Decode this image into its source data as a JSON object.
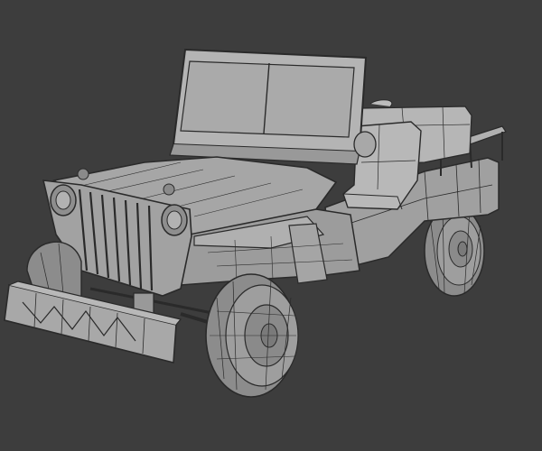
{
  "viewport": {
    "background": "#3d3d3d",
    "mesh_fill": "#9a9a9a",
    "mesh_fill_light": "#b0b0b0",
    "mesh_fill_dark": "#7c7c7c",
    "wire_color": "#2a2a2a",
    "tire_fill": "#8a8a8a"
  },
  "model": {
    "icon": "jeep-wireframe-icon"
  }
}
